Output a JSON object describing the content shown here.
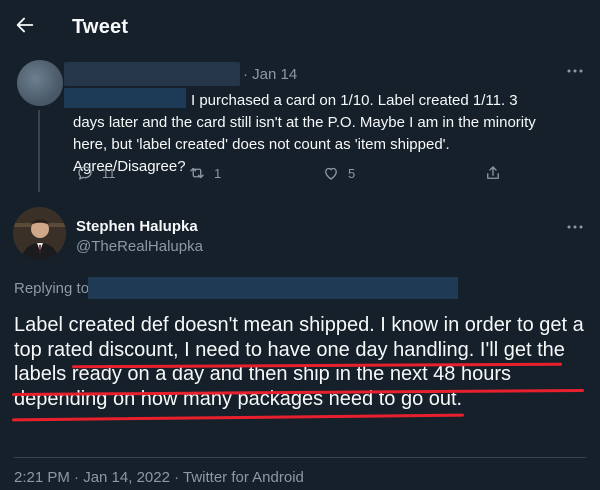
{
  "header": {
    "title": "Tweet"
  },
  "parent_tweet": {
    "date": "· Jan 14",
    "text": "I purchased a card on 1/10. Label created 1/11. 3 days later and the card still isn't at the P.O. Maybe I am in the minority here, but 'label created' does not count as 'item shipped'. Agree/Disagree?",
    "reply_count": "11",
    "retweet_count": "1",
    "like_count": "5"
  },
  "focus_tweet": {
    "author_name": "Stephen Halupka",
    "author_handle": "@TheRealHalupka",
    "replying_to_label": "Replying to",
    "body": "Label created def doesn't mean shipped. I know in order to get a top rated discount, I need to have one day handling. I'll get the labels ready on a day and then ship in the next 48 hours depending on how many packages need to go out.",
    "meta": "2:21 PM · Jan 14, 2022 · Twitter for Android"
  },
  "colors": {
    "background": "#15202b",
    "text": "#f7f9f9",
    "muted": "#8b98a5",
    "annotation_underline": "#e8202d"
  },
  "icons": [
    "back-arrow-icon",
    "more-icon",
    "reply-icon",
    "retweet-icon",
    "like-icon",
    "share-icon"
  ]
}
